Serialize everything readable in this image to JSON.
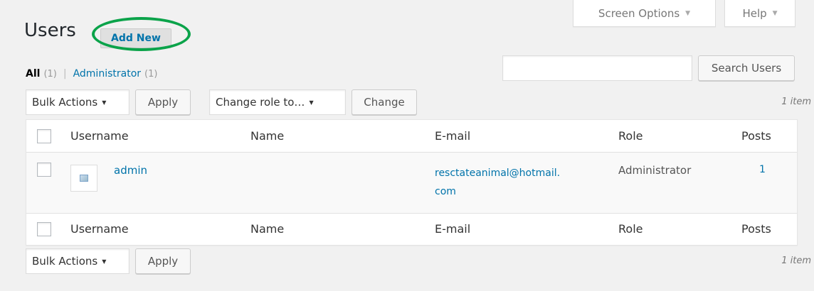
{
  "header": {
    "screen_options": "Screen Options",
    "help": "Help",
    "title": "Users",
    "add_new": "Add New"
  },
  "filters": {
    "all_label": "All",
    "all_count": "(1)",
    "admin_label": "Administrator",
    "admin_count": "(1)",
    "separator": "|"
  },
  "search": {
    "value": "",
    "button": "Search Users"
  },
  "top_nav": {
    "bulk_actions": "Bulk Actions",
    "apply": "Apply",
    "change_role": "Change role to…",
    "change": "Change",
    "item_count": "1 item"
  },
  "table": {
    "columns": [
      "Username",
      "Name",
      "E-mail",
      "Role",
      "Posts"
    ],
    "rows": [
      {
        "username": "admin",
        "name": "",
        "email_line1": "resctateanimal@hotmail.",
        "email_line2": "com",
        "role": "Administrator",
        "posts": "1"
      }
    ]
  },
  "bottom_nav": {
    "bulk_actions": "Bulk Actions",
    "apply": "Apply",
    "item_count": "1 item"
  },
  "colors": {
    "link": "#0073aa",
    "highlight_ring": "#0ba34a"
  }
}
